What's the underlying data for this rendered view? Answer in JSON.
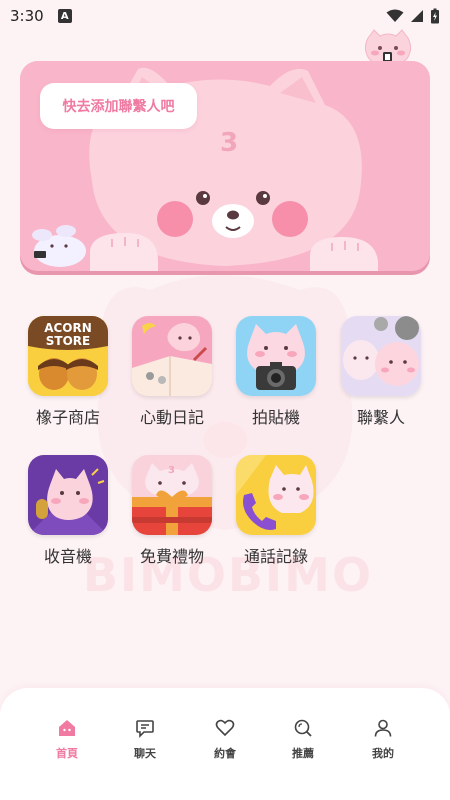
{
  "status_bar": {
    "time": "3:30",
    "notification_letter": "A"
  },
  "banner": {
    "bubble_text": "快去添加聯繫人吧"
  },
  "watermark": "BIMOBIMO",
  "apps": [
    {
      "label": "橡子商店",
      "icon_text_line1": "ACORN",
      "icon_text_line2": "STORE"
    },
    {
      "label": "心動日記"
    },
    {
      "label": "拍貼機"
    },
    {
      "label": "聯繫人"
    },
    {
      "label": "收音機"
    },
    {
      "label": "免費禮物"
    },
    {
      "label": "通話記錄"
    }
  ],
  "nav": [
    {
      "label": "首頁",
      "icon": "home-icon",
      "active": true
    },
    {
      "label": "聊天",
      "icon": "chat-icon"
    },
    {
      "label": "約會",
      "icon": "heart-icon"
    },
    {
      "label": "推薦",
      "icon": "search-icon"
    },
    {
      "label": "我的",
      "icon": "profile-icon"
    }
  ],
  "colors": {
    "accent": "#f07aa2",
    "banner_pink": "#f9b5c9",
    "background": "#fdf3f5"
  }
}
